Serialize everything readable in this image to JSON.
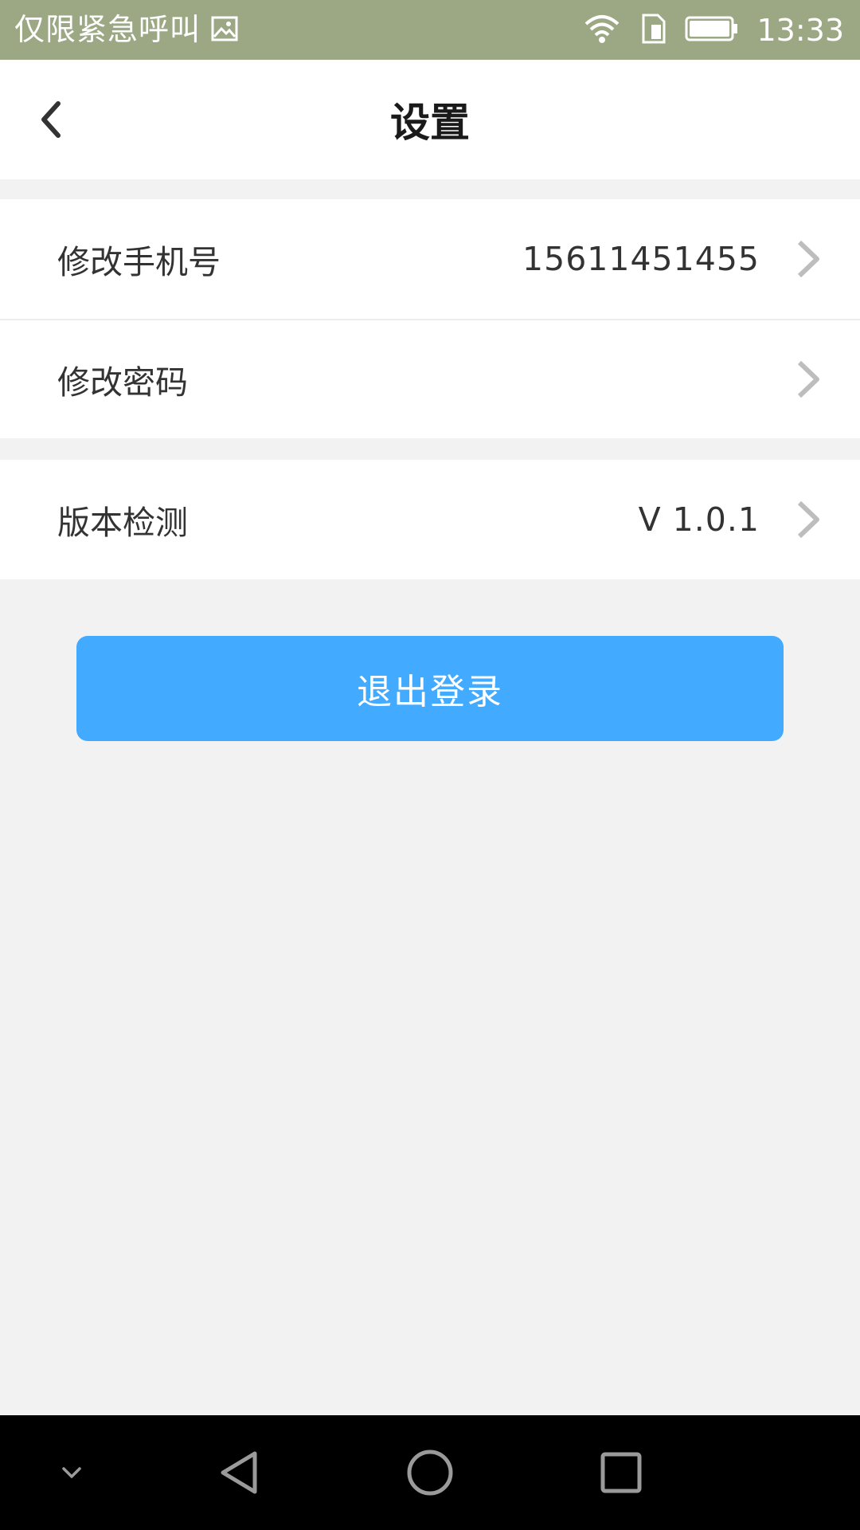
{
  "status_bar": {
    "carrier_text": "仅限紧急呼叫",
    "time": "13:33",
    "icons": [
      "image-icon",
      "wifi-icon",
      "sim-icon",
      "battery-icon"
    ]
  },
  "header": {
    "title": "设置",
    "back_icon": "chevron-left-icon"
  },
  "settings": {
    "group1": [
      {
        "label": "修改手机号",
        "value": "15611451455"
      },
      {
        "label": "修改密码",
        "value": ""
      }
    ],
    "group2": [
      {
        "label": "版本检测",
        "value": "V 1.0.1"
      }
    ]
  },
  "logout": {
    "label": "退出登录"
  },
  "colors": {
    "status_bar_bg": "#9ca884",
    "accent_button": "#42aaff",
    "page_bg": "#f2f2f3"
  },
  "nav_bar": {
    "icons": [
      "chevron-down-icon",
      "back-triangle-icon",
      "home-circle-icon",
      "recents-square-icon"
    ]
  }
}
